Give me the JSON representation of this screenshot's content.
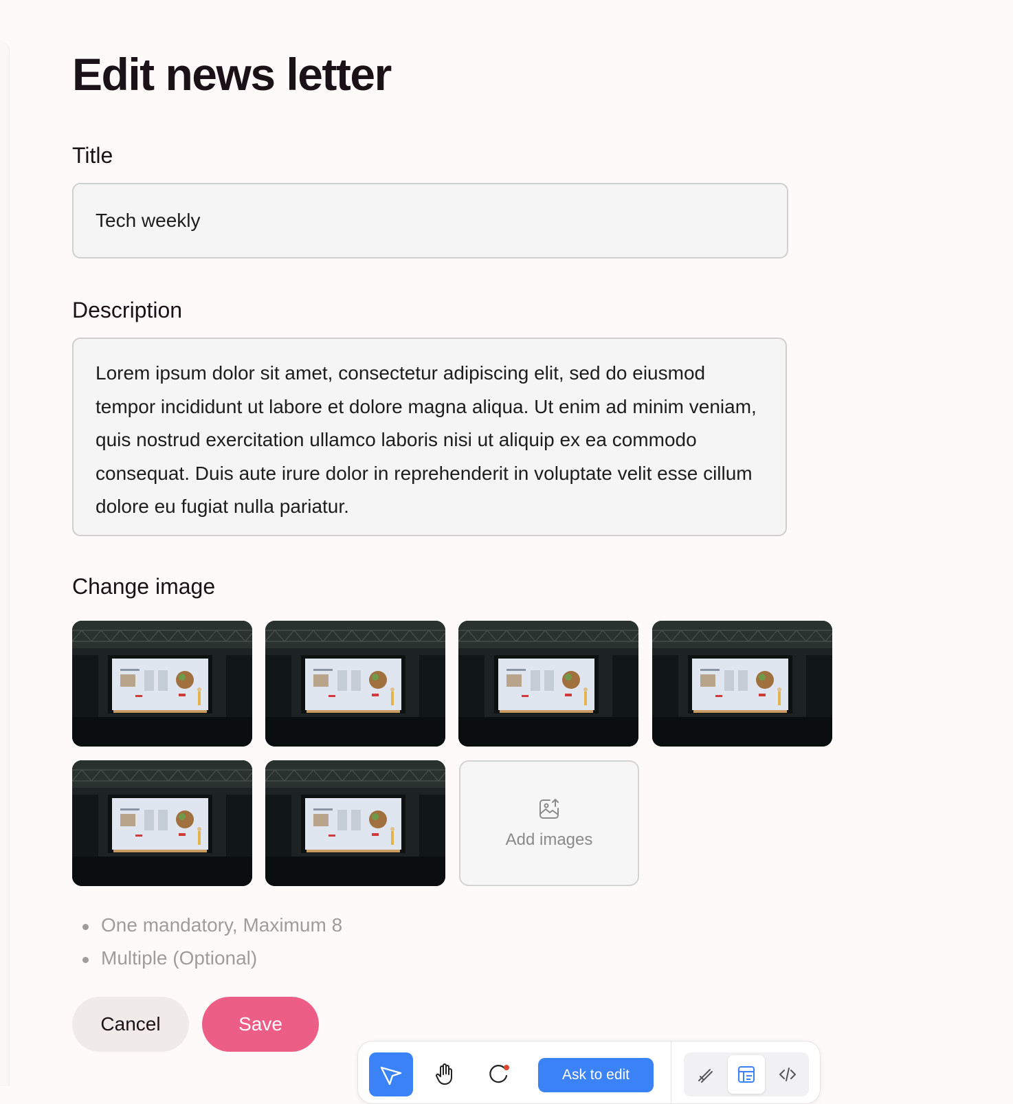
{
  "page": {
    "title": "Edit news letter"
  },
  "form": {
    "title_label": "Title",
    "title_value": "Tech weekly",
    "description_label": "Description",
    "description_value": "Lorem ipsum dolor sit amet, consectetur adipiscing elit, sed do eiusmod tempor incididunt ut labore et dolore magna aliqua. Ut enim ad minim veniam, quis nostrud exercitation ullamco laboris nisi ut aliquip ex ea commodo consequat. Duis aute irure dolor in reprehenderit in voluptate velit esse cillum dolore eu fugiat nulla pariatur.",
    "image_label": "Change image",
    "images": [
      {
        "name": "presentation-photo",
        "icon": "presentation-photo"
      },
      {
        "name": "presentation-photo",
        "icon": "presentation-photo"
      },
      {
        "name": "presentation-photo",
        "icon": "presentation-photo"
      },
      {
        "name": "presentation-photo",
        "icon": "presentation-photo"
      },
      {
        "name": "presentation-photo",
        "icon": "presentation-photo"
      },
      {
        "name": "presentation-photo",
        "icon": "presentation-photo"
      }
    ],
    "add_images_label": "Add images",
    "add_images_icon": "image-upload-icon",
    "hints": [
      "One mandatory, Maximum 8",
      "Multiple (Optional)"
    ],
    "cancel_label": "Cancel",
    "save_label": "Save"
  },
  "toolbar": {
    "tools": [
      "cursor-icon",
      "hand-icon",
      "comment-icon"
    ],
    "ask_label": "Ask to edit",
    "modes": [
      "pen-icon",
      "layout-icon",
      "code-icon"
    ],
    "active_tool": "cursor-icon",
    "selected_mode": "layout-icon"
  },
  "colors": {
    "background": "#fdfaf9",
    "save": "#ec5e86",
    "cancel": "#f0eaea",
    "accent": "#3b82f6"
  }
}
